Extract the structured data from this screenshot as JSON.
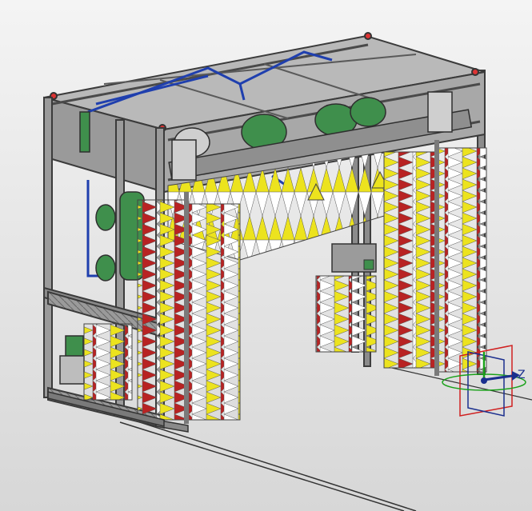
{
  "viewport": {
    "background_top": "#f4f4f4",
    "background_bottom": "#d7d7d7"
  },
  "model": {
    "frame_color": "#4d4d4d",
    "frame_light": "#a9a9a9",
    "pipe_color": "#1f3fae",
    "motor_color": "#3f8f4c",
    "bristle_colors": [
      "#ece31e",
      "#b82323",
      "#ffffff"
    ]
  },
  "triad": {
    "axis_label": "Z",
    "x_color": "#d02020",
    "y_color": "#1aa11a",
    "z_color": "#1b2f8e"
  }
}
